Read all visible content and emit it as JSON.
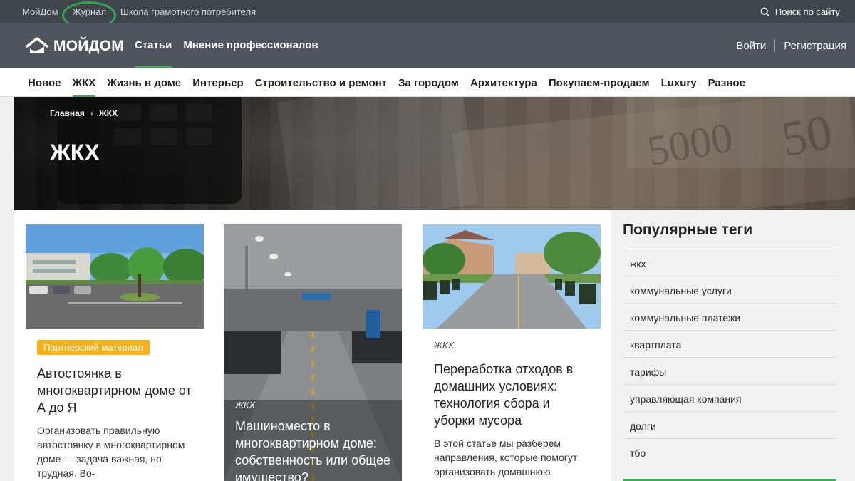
{
  "topbar": {
    "links": [
      "МойДом",
      "Журнал",
      "Школа грамотного потребителя"
    ],
    "search_label": "Поиск по сайту"
  },
  "header": {
    "logo_text": "МОЙДОМ",
    "nav": [
      "Статьи",
      "Мнение профессионалов"
    ],
    "login": "Войти",
    "register": "Регистрация"
  },
  "categories": [
    "Новое",
    "ЖКХ",
    "Жизнь в доме",
    "Интерьер",
    "Строительство и ремонт",
    "За городом",
    "Архитектура",
    "Покупаем-продаем",
    "Luxury",
    "Разное"
  ],
  "hero": {
    "breadcrumb_home": "Главная",
    "breadcrumb_sep": "›",
    "breadcrumb_current": "ЖКХ",
    "title": "ЖКХ"
  },
  "cards": [
    {
      "badge": "Партнерский материал",
      "title": "Автостоянка в многоквартирном доме от А до Я",
      "desc": "Организовать правильную автостоянку в многоквартирном доме — задача важная, но трудная. Во-"
    },
    {
      "rubric": "ЖКХ",
      "title": "Машиноместо в многоквартирном доме: собственность или общее имущество?"
    },
    {
      "rubric": "ЖКХ",
      "title": "Переработка отходов в домашних условиях: технология сбора и уборки мусора",
      "desc": "В этой статье мы разберем направления, которые помогут организовать домашнюю"
    }
  ],
  "sidebar": {
    "title": "Популярные теги",
    "tags": [
      "жкх",
      "коммунальные услуги",
      "коммунальные платежи",
      "квартплата",
      "тарифы",
      "управляющая компания",
      "долги",
      "тбо"
    ]
  },
  "colors": {
    "accent": "#3cab54",
    "badge": "#f6b21a",
    "topbar_bg": "#3f454b",
    "header_bg": "#4e555c"
  }
}
